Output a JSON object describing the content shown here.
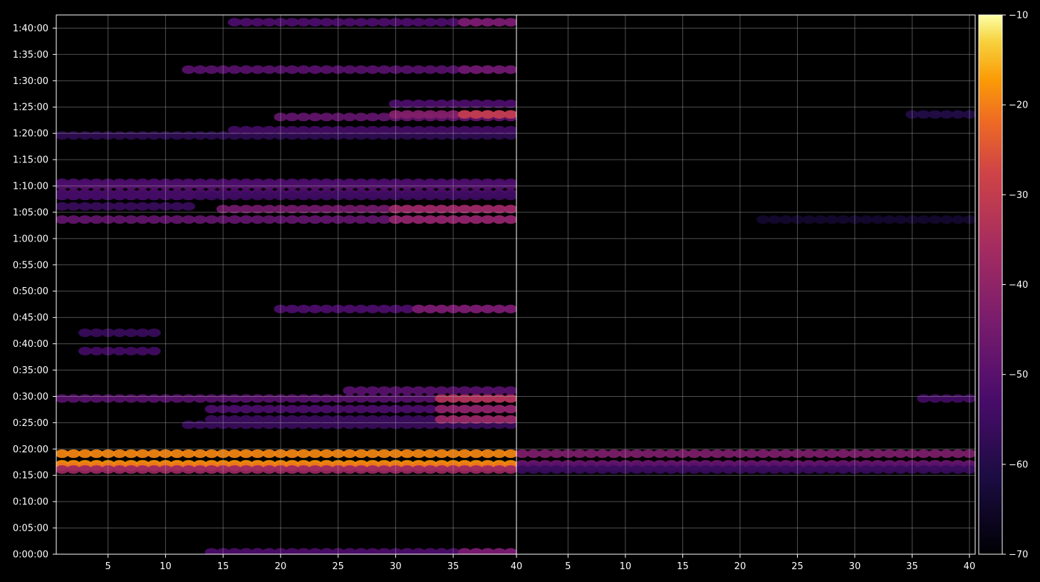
{
  "chart_data": {
    "type": "heatmap",
    "title": "",
    "xlabel": "",
    "ylabel": "",
    "grid": true,
    "panels": [
      {
        "name": "",
        "x_range": [
          1,
          40
        ],
        "x_ticks": [
          5,
          10,
          15,
          20,
          25,
          30,
          35
        ],
        "x_tick_labels": [
          "5",
          "10",
          "15",
          "20",
          "25",
          "30",
          "35"
        ]
      },
      {
        "name": "",
        "x_range": [
          1,
          40
        ],
        "x_ticks": [
          5,
          10,
          15,
          20,
          25,
          30,
          35,
          40
        ],
        "x_tick_labels": [
          "5",
          "10",
          "15",
          "20",
          "25",
          "30",
          "35",
          "40"
        ]
      }
    ],
    "shared_x_boundary_label": "40",
    "y_range_seconds": [
      0,
      6150
    ],
    "y_ticks_seconds": [
      0,
      300,
      600,
      900,
      1200,
      1500,
      1800,
      2100,
      2400,
      2700,
      3000,
      3300,
      3600,
      3900,
      4200,
      4500,
      4800,
      5100,
      5400,
      5700,
      6000
    ],
    "y_tick_labels": [
      "0:00:00",
      "0:05:00",
      "0:10:00",
      "0:15:00",
      "0:20:00",
      "0:25:00",
      "0:30:00",
      "0:35:00",
      "0:40:00",
      "0:45:00",
      "0:50:00",
      "0:55:00",
      "1:00:00",
      "1:05:00",
      "1:10:00",
      "1:15:00",
      "1:20:00",
      "1:25:00",
      "1:30:00",
      "1:35:00",
      "1:40:00"
    ],
    "colorbar": {
      "colormap": "inferno",
      "min": -70,
      "max": -10,
      "ticks": [
        -10,
        -20,
        -30,
        -40,
        -50,
        -60,
        -70
      ],
      "tick_labels": [
        "−10",
        "−20",
        "−30",
        "−40",
        "−50",
        "−60",
        "−70"
      ]
    },
    "series": [
      {
        "panel": 0,
        "rows": [
          {
            "t": 1146,
            "x0": 1,
            "x1": 40,
            "v": -19
          },
          {
            "t": 1026,
            "x0": 1,
            "x1": 40,
            "v": -18
          },
          {
            "t": 996,
            "x0": 1,
            "x1": 40,
            "v": -21
          },
          {
            "t": 966,
            "x0": 1,
            "x1": 40,
            "v": -38
          },
          {
            "t": 1776,
            "x0": 1,
            "x1": 40,
            "v": -50
          },
          {
            "t": 1656,
            "x0": 14,
            "x1": 40,
            "v": -52
          },
          {
            "t": 1536,
            "x0": 14,
            "x1": 40,
            "v": -55
          },
          {
            "t": 1476,
            "x0": 12,
            "x1": 40,
            "v": -56
          },
          {
            "t": 1536,
            "x0": 34,
            "x1": 40,
            "v": -38
          },
          {
            "t": 1656,
            "x0": 34,
            "x1": 40,
            "v": -40
          },
          {
            "t": 1776,
            "x0": 34,
            "x1": 40,
            "v": -33
          },
          {
            "t": 1866,
            "x0": 26,
            "x1": 40,
            "v": -50
          },
          {
            "t": 2796,
            "x0": 20,
            "x1": 40,
            "v": -52
          },
          {
            "t": 2796,
            "x0": 32,
            "x1": 40,
            "v": -44
          },
          {
            "t": 3816,
            "x0": 1,
            "x1": 40,
            "v": -48
          },
          {
            "t": 3936,
            "x0": 15,
            "x1": 40,
            "v": -45
          },
          {
            "t": 3816,
            "x0": 30,
            "x1": 40,
            "v": -40
          },
          {
            "t": 3936,
            "x0": 30,
            "x1": 40,
            "v": -38
          },
          {
            "t": 4116,
            "x0": 1,
            "x1": 40,
            "v": -52
          },
          {
            "t": 4206,
            "x0": 1,
            "x1": 40,
            "v": -50
          },
          {
            "t": 4236,
            "x0": 1,
            "x1": 40,
            "v": -52
          },
          {
            "t": 4086,
            "x0": 1,
            "x1": 40,
            "v": -55
          },
          {
            "t": 4986,
            "x0": 20,
            "x1": 40,
            "v": -48
          },
          {
            "t": 5016,
            "x0": 30,
            "x1": 40,
            "v": -42
          },
          {
            "t": 5016,
            "x0": 36,
            "x1": 40,
            "v": -30
          },
          {
            "t": 4776,
            "x0": 1,
            "x1": 40,
            "v": -58
          },
          {
            "t": 4836,
            "x0": 16,
            "x1": 40,
            "v": -54
          },
          {
            "t": 5136,
            "x0": 30,
            "x1": 40,
            "v": -52
          },
          {
            "t": 5526,
            "x0": 12,
            "x1": 40,
            "v": -50
          },
          {
            "t": 5526,
            "x0": 36,
            "x1": 40,
            "v": -46
          },
          {
            "t": 6066,
            "x0": 16,
            "x1": 40,
            "v": -52
          },
          {
            "t": 6066,
            "x0": 36,
            "x1": 40,
            "v": -44
          },
          {
            "t": 21,
            "x0": 14,
            "x1": 40,
            "v": -52
          },
          {
            "t": 21,
            "x0": 36,
            "x1": 40,
            "v": -44
          },
          {
            "t": 2316,
            "x0": 3,
            "x1": 9,
            "v": -54
          },
          {
            "t": 2526,
            "x0": 3,
            "x1": 9,
            "v": -56
          },
          {
            "t": 3966,
            "x0": 1,
            "x1": 12,
            "v": -56
          },
          {
            "t": 4086,
            "x0": 1,
            "x1": 12,
            "v": -54
          }
        ]
      },
      {
        "panel": 1,
        "rows": [
          {
            "t": 1146,
            "x0": 1,
            "x1": 40,
            "v": -43
          },
          {
            "t": 1026,
            "x0": 1,
            "x1": 40,
            "v": -47
          },
          {
            "t": 996,
            "x0": 1,
            "x1": 40,
            "v": -50
          },
          {
            "t": 966,
            "x0": 1,
            "x1": 40,
            "v": -56
          },
          {
            "t": 1776,
            "x0": 36,
            "x1": 40,
            "v": -54
          },
          {
            "t": 3816,
            "x0": 22,
            "x1": 40,
            "v": -64
          },
          {
            "t": 5016,
            "x0": 35,
            "x1": 40,
            "v": -60
          }
        ]
      }
    ]
  }
}
